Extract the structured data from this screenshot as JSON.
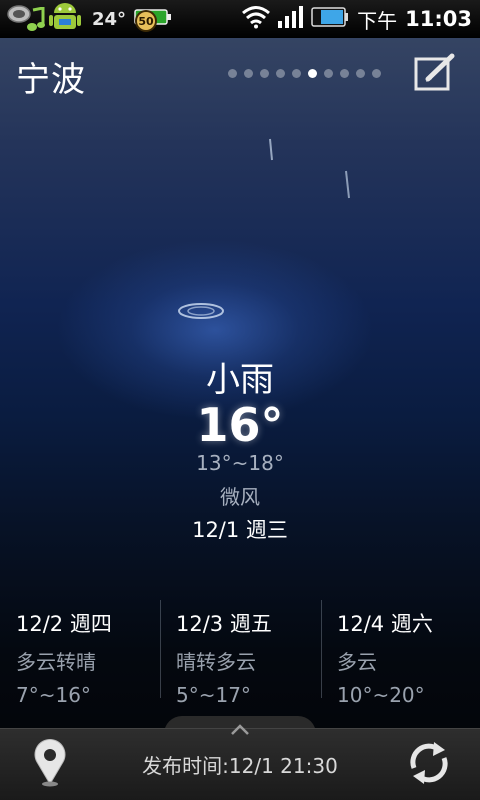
{
  "status_bar": {
    "temperature": "24°",
    "battery_badge": "50",
    "ampm": "下午",
    "time": "11:03"
  },
  "header": {
    "city": "宁波",
    "page_count": 10,
    "active_page": 5
  },
  "current": {
    "condition": "小雨",
    "temperature": "16°",
    "range": "13°~18°",
    "wind": "微风",
    "date": "12/1 週三"
  },
  "forecast": [
    {
      "date": "12/2 週四",
      "condition": "多云转晴",
      "range": "7°~16°"
    },
    {
      "date": "12/3 週五",
      "condition": "晴转多云",
      "range": "5°~17°"
    },
    {
      "date": "12/4 週六",
      "condition": "多云",
      "range": "10°~20°"
    }
  ],
  "bottom_bar": {
    "publish_time": "发布时间:12/1 21:30"
  },
  "icons": {
    "status_left": [
      "cloud-sync-icon",
      "music-note-icon",
      "android-icon",
      "battery-icon"
    ],
    "status_right": [
      "wifi-icon",
      "signal-icon",
      "battery-level-icon"
    ],
    "header": [
      "edit-icon"
    ],
    "bottom": [
      "location-pin-icon",
      "refresh-icon",
      "chevron-up-icon"
    ]
  },
  "colors": {
    "accent_blue": "#2f63c8",
    "text_primary": "#ffffff",
    "text_secondary": "#a7b0bf"
  }
}
